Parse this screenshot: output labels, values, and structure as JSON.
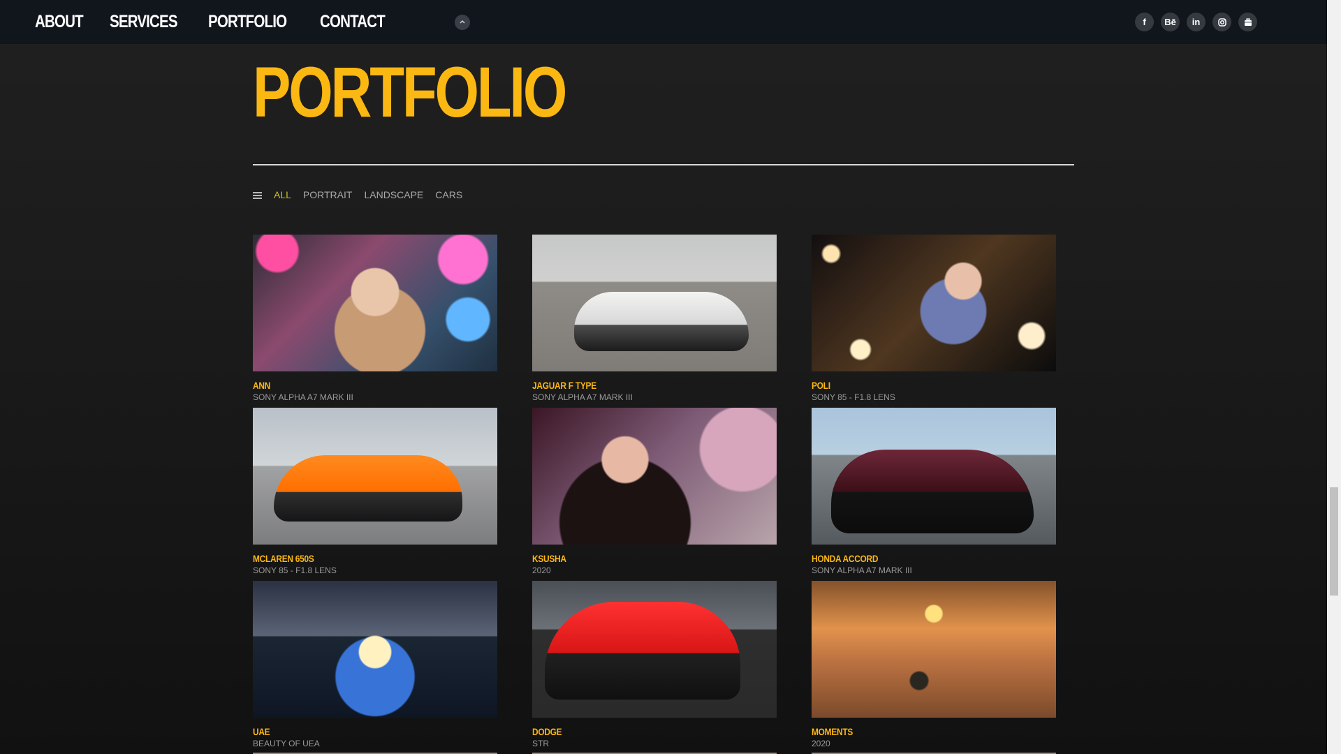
{
  "nav": {
    "items": [
      {
        "label": "ABOUT"
      },
      {
        "label": "SERVICES"
      },
      {
        "label": "PORTFOLIO"
      },
      {
        "label": "CONTACT"
      }
    ],
    "social": [
      {
        "label": "f",
        "icon": "facebook-icon"
      },
      {
        "label": "Bē",
        "icon": "behance-icon"
      },
      {
        "label": "in",
        "icon": "linkedin-icon"
      },
      {
        "label": "",
        "icon": "instagram-icon"
      },
      {
        "label": "",
        "icon": "briefcase-icon"
      }
    ]
  },
  "page": {
    "title": "PORTFOLIO",
    "filters": [
      "ALL",
      "PORTRAIT",
      "LANDSCAPE",
      "CARS"
    ]
  },
  "gallery": [
    {
      "title": "ANN",
      "subtitle": "SONY ALPHA A7 MARK III"
    },
    {
      "title": "JAGUAR F TYPE",
      "subtitle": "SONY ALPHA A7 MARK III"
    },
    {
      "title": "POLI",
      "subtitle": "SONY 85 - F1.8 LENS"
    },
    {
      "title": "MCLAREN 650S",
      "subtitle": "SONY 85 - F1.8 LENS"
    },
    {
      "title": "KSUSHA",
      "subtitle": "2020"
    },
    {
      "title": "HONDA ACCORD",
      "subtitle": "SONY ALPHA A7 MARK III"
    },
    {
      "title": "UAE",
      "subtitle": "BEAUTY OF UEA"
    },
    {
      "title": "DODGE",
      "subtitle": "STR"
    },
    {
      "title": "MOMENTS",
      "subtitle": "2020"
    }
  ],
  "theme": {
    "accent": "#fcb812",
    "active_filter": "#c7c11e",
    "topbar": "#11161d"
  }
}
